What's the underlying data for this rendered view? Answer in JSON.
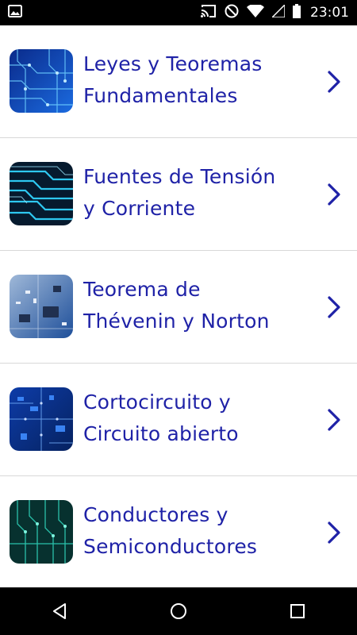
{
  "status_bar": {
    "time": "23:01",
    "icons": [
      "image-icon",
      "cast-icon",
      "do-not-disturb-icon",
      "wifi-icon",
      "signal-icon",
      "battery-icon"
    ]
  },
  "list": {
    "items": [
      {
        "line1": "Leyes y Teoremas",
        "line2": "Fundamentales",
        "thumb": "circuit-blue-icon"
      },
      {
        "line1": "Fuentes de Tensión",
        "line2": "y Corriente",
        "thumb": "circuit-cyan-icon"
      },
      {
        "line1": "Teorema de",
        "line2": "Thévenin y Norton",
        "thumb": "circuit-board-icon"
      },
      {
        "line1": "Cortocircuito y",
        "line2": "Circuito abierto",
        "thumb": "circuit-chip-icon"
      },
      {
        "line1": "Conductores y",
        "line2": "Semiconductores",
        "thumb": "circuit-teal-icon"
      }
    ]
  },
  "nav_bar": {
    "buttons": [
      "back-icon",
      "home-icon",
      "recents-icon"
    ]
  },
  "colors": {
    "text": "#1f22a7",
    "divider": "#d8d8d8",
    "bars": "#000000"
  }
}
